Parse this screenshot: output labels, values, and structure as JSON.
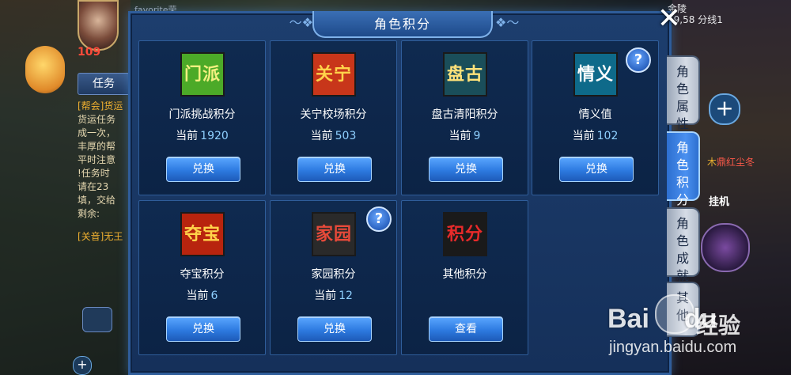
{
  "background": {
    "hud_top_text": "favorite荣",
    "map_text": "金陵\n59,58 分线1",
    "level": "109",
    "task_tab": "任务",
    "task_lines": [
      "[帮会]货运",
      "货运任务",
      "成一次，",
      "丰厚的帮",
      "平时注意",
      "!任务时",
      "请在23",
      "填，交给",
      "剩余:"
    ],
    "task_footer": "[关音]无王",
    "swords_text_gold": "木",
    "swords_text_red": "鼎红尘冬",
    "idle_label": "挂机"
  },
  "panel": {
    "title": "角色积分",
    "close_label": "✕"
  },
  "cards": [
    {
      "icon_text": "门派",
      "icon_bg": "#4caa28",
      "icon_color": "#f4f080",
      "name": "门派挑战积分",
      "value_label": "当前",
      "value": "1920",
      "button": "兑换",
      "help": false
    },
    {
      "icon_text": "关宁",
      "icon_bg": "#c8361a",
      "icon_color": "#ffd34a",
      "name": "关宁校场积分",
      "value_label": "当前",
      "value": "503",
      "button": "兑换",
      "help": false
    },
    {
      "icon_text": "盘古",
      "icon_bg": "#1a4e5a",
      "icon_color": "#ffe27a",
      "name": "盘古清阳积分",
      "value_label": "当前",
      "value": "9",
      "button": "兑换",
      "help": false
    },
    {
      "icon_text": "情义",
      "icon_bg": "#0e6a8a",
      "icon_color": "#ffffff",
      "name": "情义值",
      "value_label": "当前",
      "value": "102",
      "button": "兑换",
      "help": true
    },
    {
      "icon_text": "夺宝",
      "icon_bg": "#b8240e",
      "icon_color": "#ffd34a",
      "name": "夺宝积分",
      "value_label": "当前",
      "value": "6",
      "button": "兑换",
      "help": false
    },
    {
      "icon_text": "家园",
      "icon_bg": "#2a2a2a",
      "icon_color": "#e84a3a",
      "name": "家园积分",
      "value_label": "当前",
      "value": "12",
      "button": "兑换",
      "help": true
    },
    {
      "icon_text": "积分",
      "icon_bg": "#1a1a1a",
      "icon_color": "#e82a2a",
      "name": "其他积分",
      "value_label": "",
      "value": "",
      "button": "查看",
      "help": false
    }
  ],
  "help_label": "?",
  "side_tabs": [
    {
      "label": "角色属性",
      "active": false
    },
    {
      "label": "角色积分",
      "active": true
    },
    {
      "label": "角色成就",
      "active": false
    },
    {
      "label": "其他",
      "active": false
    }
  ],
  "watermark": {
    "logo": "Bai",
    "logo2": "du",
    "jingyan": "经验",
    "url": "jingyan.baidu.com"
  }
}
